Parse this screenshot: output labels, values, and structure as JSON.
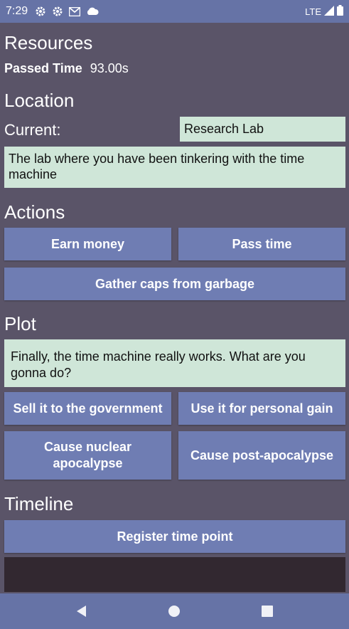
{
  "status_bar": {
    "time": "7:29",
    "icons": [
      "gear-icon",
      "gear-icon",
      "gmail-icon",
      "cloud-icon"
    ],
    "network": "LTE",
    "right_icons": [
      "signal-icon",
      "battery-icon"
    ]
  },
  "resources": {
    "heading": "Resources",
    "passed_time_label": "Passed Time",
    "passed_time_value": "93.00s"
  },
  "location": {
    "heading": "Location",
    "current_label": "Current:",
    "current_value": "Research Lab",
    "description": "The lab where you have been tinkering with the time machine"
  },
  "actions": {
    "heading": "Actions",
    "earn_money": "Earn money",
    "pass_time": "Pass time",
    "gather_caps": "Gather caps from garbage"
  },
  "plot": {
    "heading": "Plot",
    "text": "Finally, the time machine really works. What are you gonna do?",
    "sell": "Sell it to the government",
    "use": "Use it for personal gain",
    "nuclear": "Cause nuclear apocalypse",
    "post": "Cause post-apocalypse"
  },
  "timeline": {
    "heading": "Timeline",
    "register": "Register time point"
  },
  "nav": {
    "icons": [
      "back-icon",
      "home-icon",
      "recents-icon"
    ]
  },
  "colors": {
    "background": "#5a5468",
    "bar": "#6673a6",
    "button": "#6f7db3",
    "textbox": "#cfe6d8",
    "timeline_area": "#322830"
  }
}
